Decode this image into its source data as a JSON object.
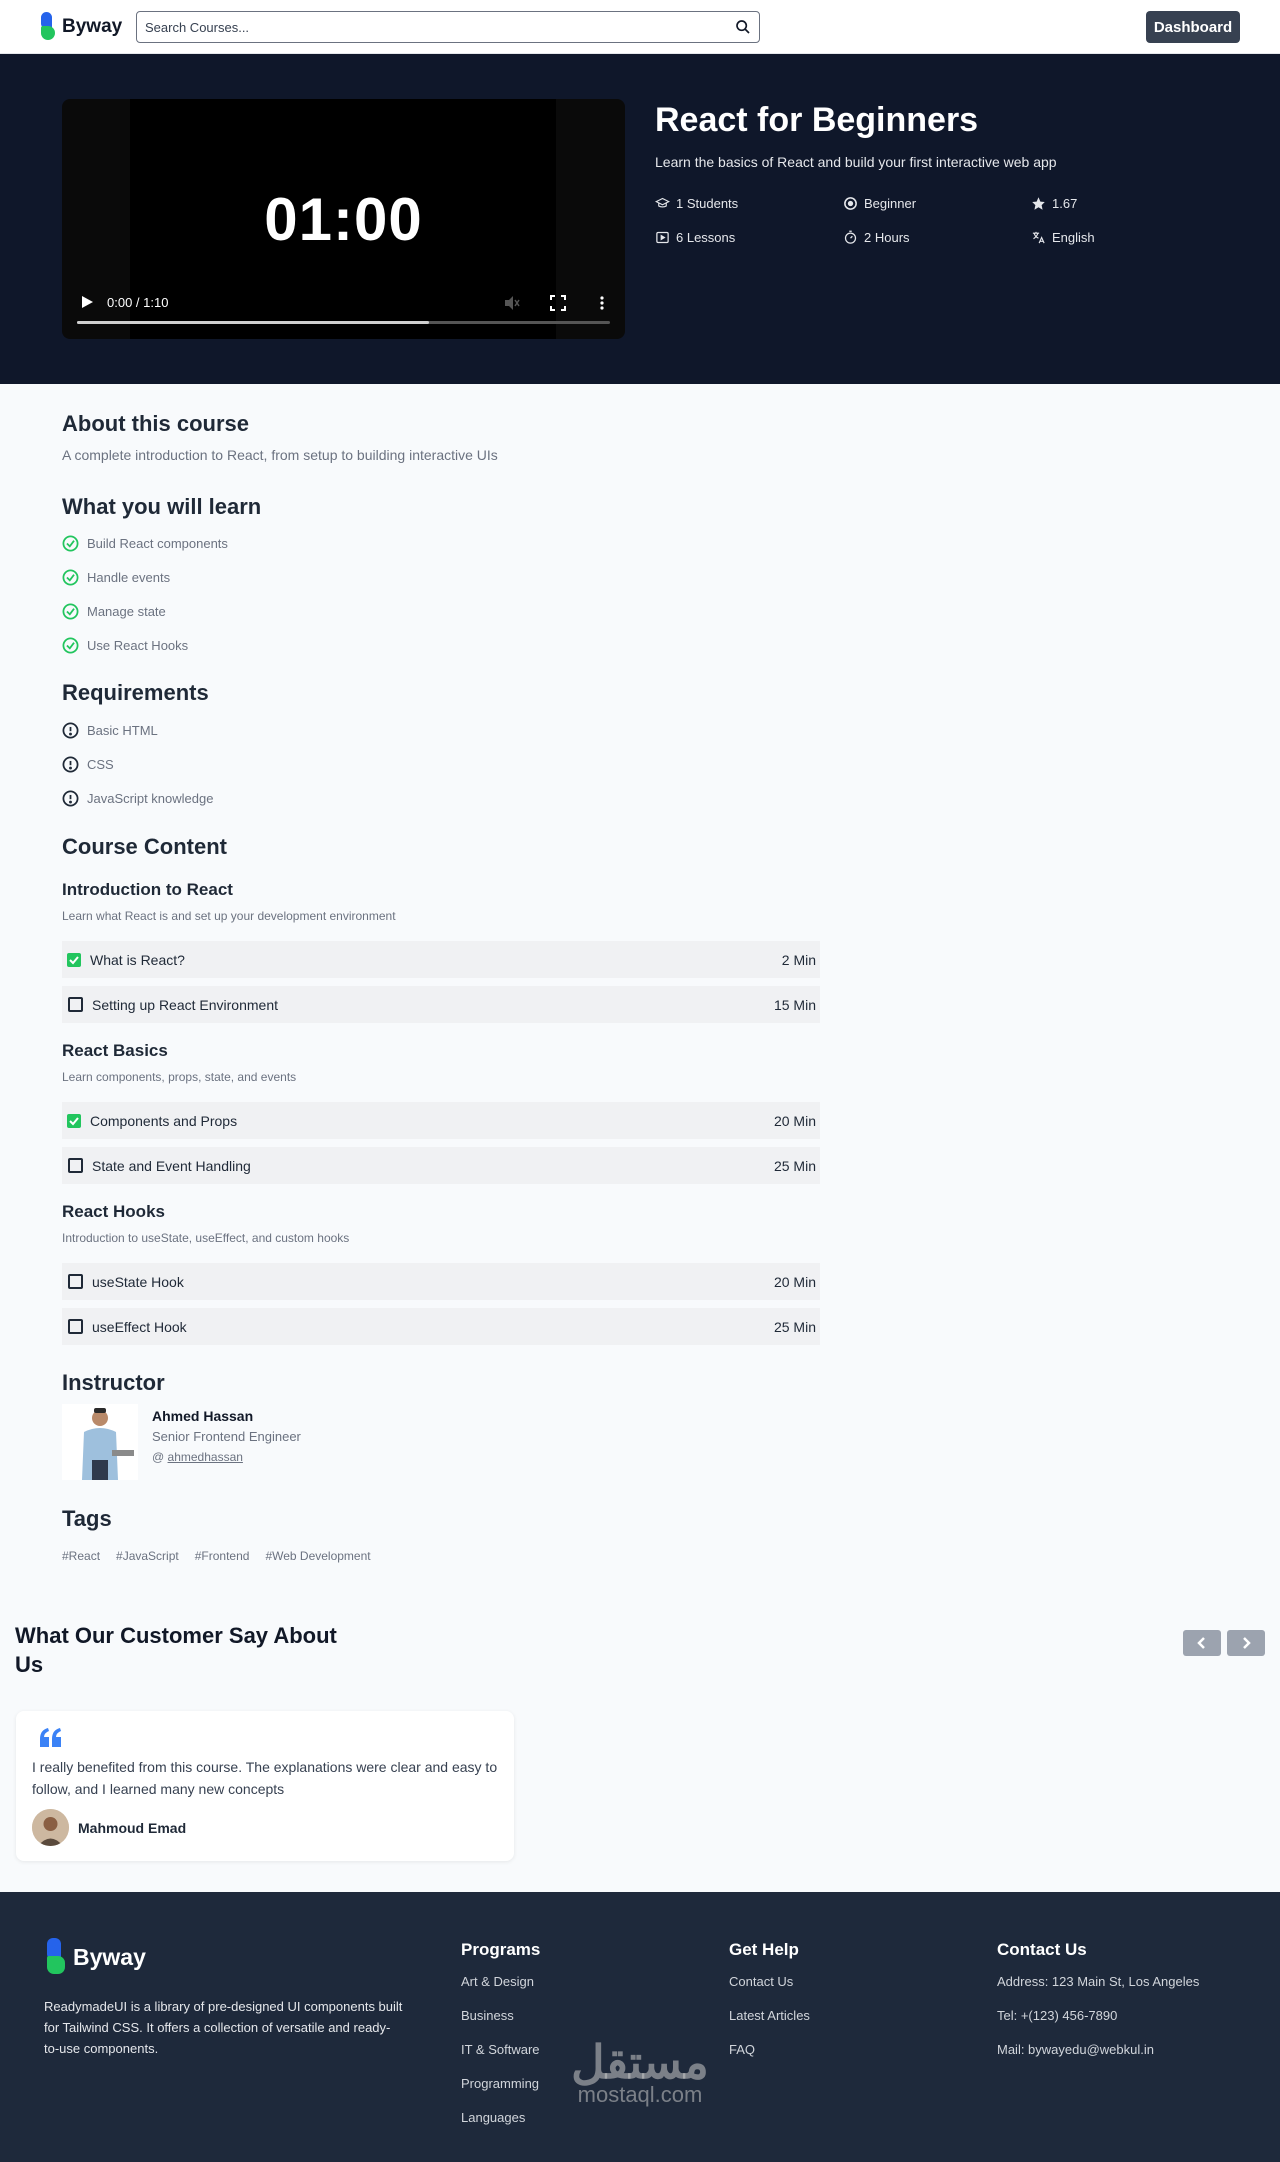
{
  "header": {
    "logo_text": "Byway",
    "search_placeholder": "Search Courses...",
    "dashboard_label": "Dashboard"
  },
  "video": {
    "overlay_time": "01:00",
    "time_display": "0:00 / 1:10",
    "progress_fraction": 0.66
  },
  "course": {
    "title": "React for Beginners",
    "subtitle": "Learn the basics of React and build your first interactive web app",
    "stats": {
      "students": "1 Students",
      "level": "Beginner",
      "rating": "1.67",
      "lessons": "6 Lessons",
      "duration": "2 Hours",
      "language": "English"
    }
  },
  "about": {
    "heading": "About this course",
    "text": "A complete introduction to React, from setup to building interactive UIs"
  },
  "learn": {
    "heading": "What you will learn",
    "items": [
      "Build React components",
      "Handle events",
      "Manage state",
      "Use React Hooks"
    ]
  },
  "requirements": {
    "heading": "Requirements",
    "items": [
      "Basic HTML",
      "CSS",
      "JavaScript knowledge"
    ]
  },
  "content": {
    "heading": "Course Content",
    "sections": [
      {
        "title": "Introduction to React",
        "desc": "Learn what React is and set up your development environment",
        "lessons": [
          {
            "title": "What is React?",
            "duration": "2 Min",
            "done": true
          },
          {
            "title": "Setting up React Environment",
            "duration": "15 Min",
            "done": false
          }
        ]
      },
      {
        "title": "React Basics",
        "desc": "Learn components, props, state, and events",
        "lessons": [
          {
            "title": "Components and Props",
            "duration": "20 Min",
            "done": true
          },
          {
            "title": "State and Event Handling",
            "duration": "25 Min",
            "done": false
          }
        ]
      },
      {
        "title": "React Hooks",
        "desc": "Introduction to useState, useEffect, and custom hooks",
        "lessons": [
          {
            "title": "useState Hook",
            "duration": "20 Min",
            "done": false
          },
          {
            "title": "useEffect Hook",
            "duration": "25 Min",
            "done": false
          }
        ]
      }
    ]
  },
  "instructor": {
    "heading": "Instructor",
    "name": "Ahmed Hassan",
    "role": "Senior Frontend Engineer",
    "handle_prefix": "@",
    "handle": "ahmedhassan"
  },
  "tags": {
    "heading": "Tags",
    "items": [
      "#React",
      "#JavaScript",
      "#Frontend",
      "#Web Development"
    ]
  },
  "testimonials": {
    "heading": "What Our Customer Say About Us",
    "items": [
      {
        "text": "I really benefited from this course. The explanations were clear and easy to follow, and I learned many new concepts",
        "name": "Mahmoud Emad"
      }
    ]
  },
  "footer": {
    "logo_text": "Byway",
    "description": "ReadymadeUI is a library of pre-designed UI components built for Tailwind CSS. It offers a collection of versatile and ready-to-use components.",
    "programs": {
      "heading": "Programs",
      "links": [
        "Art & Design",
        "Business",
        "IT & Software",
        "Programming",
        "Languages"
      ]
    },
    "help": {
      "heading": "Get Help",
      "links": [
        "Contact Us",
        "Latest Articles",
        "FAQ"
      ]
    },
    "contact": {
      "heading": "Contact Us",
      "address": "Address: 123 Main St, Los Angeles",
      "tel": "Tel: +(123) 456-7890",
      "mail": "Mail: bywayedu@webkul.in"
    }
  },
  "watermark": {
    "arabic": "مستقل",
    "latin": "mostaql.com"
  },
  "colors": {
    "hero_bg": "#0f172a",
    "footer_bg": "#1e293b",
    "check_green": "#22c55e",
    "brand_blue": "#2563eb",
    "dashboard_btn": "#374151"
  },
  "icons": {
    "students": "graduation-cap-icon",
    "level": "target-icon",
    "rating": "star-icon",
    "lessons": "video-icon",
    "duration": "stopwatch-icon",
    "language": "translate-icon",
    "learn_item": "check-circle-icon",
    "requirement_item": "exclamation-circle-icon"
  }
}
